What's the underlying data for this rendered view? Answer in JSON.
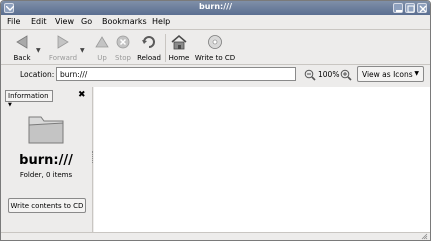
{
  "window": {
    "title": "burn:///"
  },
  "menubar": {
    "items": [
      "File",
      "Edit",
      "View",
      "Go",
      "Bookmarks",
      "Help"
    ]
  },
  "toolbar": {
    "back": "Back",
    "forward": "Forward",
    "up": "Up",
    "stop": "Stop",
    "reload": "Reload",
    "home": "Home",
    "write_to_cd": "Write to CD"
  },
  "location": {
    "label": "Location:",
    "value": "burn:///",
    "zoom_level": "100%",
    "view_mode": "View as Icons"
  },
  "sidepane": {
    "selector": "Information",
    "name": "burn:///",
    "info": "Folder, 0 items",
    "write_button": "Write contents to CD"
  },
  "colors": {
    "titlebar": "#6a7c9c",
    "window_bg": "#edeceb",
    "content_bg": "#ffffff"
  }
}
